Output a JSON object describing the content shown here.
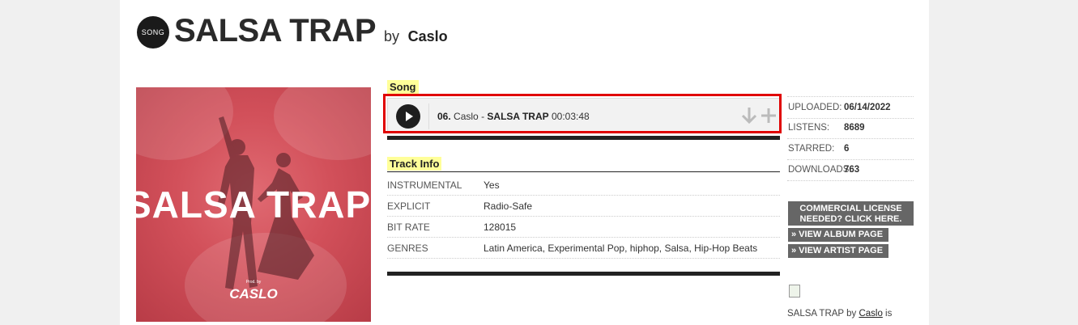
{
  "header": {
    "badge_text": "SONG",
    "title": "SALSA TRAP",
    "by_label": "by",
    "artist": "Caslo"
  },
  "cover": {
    "word": "SALSA TRAP",
    "prod_text": "Prod. by",
    "logo_text": "CASLO",
    "background_color": "#d2505a"
  },
  "song_section": {
    "label": "Song",
    "track_number": "06.",
    "track_artist": "Caslo",
    "track_dash": "-",
    "track_title": "SALSA TRAP",
    "duration": "00:03:48",
    "download_icon": "download-arrow-icon",
    "add_icon": "plus-icon"
  },
  "track_info": {
    "label": "Track Info",
    "rows": [
      {
        "key": "INSTRUMENTAL",
        "value": "Yes"
      },
      {
        "key": "EXPLICIT",
        "value": "Radio-Safe"
      },
      {
        "key": "BIT RATE",
        "value": "128015"
      },
      {
        "key": "GENRES",
        "value": "Latin America, Experimental Pop, hiphop, Salsa, Hip-Hop Beats"
      }
    ]
  },
  "stats": [
    {
      "key": "UPLOADED:",
      "value": "06/14/2022"
    },
    {
      "key": "LISTENS:",
      "value": "8689"
    },
    {
      "key": "STARRED:",
      "value": "6"
    },
    {
      "key": "DOWNLOADS:",
      "value": "763"
    }
  ],
  "buttons": {
    "license": "COMMERCIAL LICENSE NEEDED?  CLICK HERE.",
    "album": "» VIEW ALBUM PAGE",
    "artist": "» VIEW ARTIST PAGE"
  },
  "description": {
    "prefix": "SALSA TRAP by",
    "artist_link": "Caslo",
    "suffix": "is"
  },
  "colors": {
    "highlight_border": "#e00000",
    "label_highlight": "#ffff99",
    "button_bg": "#666666"
  }
}
